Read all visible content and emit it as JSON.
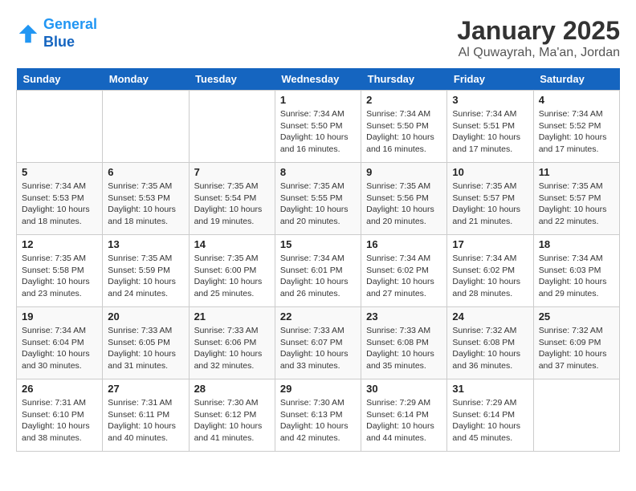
{
  "header": {
    "logo_line1": "General",
    "logo_line2": "Blue",
    "month": "January 2025",
    "location": "Al Quwayrah, Ma'an, Jordan"
  },
  "weekdays": [
    "Sunday",
    "Monday",
    "Tuesday",
    "Wednesday",
    "Thursday",
    "Friday",
    "Saturday"
  ],
  "weeks": [
    [
      {
        "day": "",
        "info": ""
      },
      {
        "day": "",
        "info": ""
      },
      {
        "day": "",
        "info": ""
      },
      {
        "day": "1",
        "info": "Sunrise: 7:34 AM\nSunset: 5:50 PM\nDaylight: 10 hours\nand 16 minutes."
      },
      {
        "day": "2",
        "info": "Sunrise: 7:34 AM\nSunset: 5:50 PM\nDaylight: 10 hours\nand 16 minutes."
      },
      {
        "day": "3",
        "info": "Sunrise: 7:34 AM\nSunset: 5:51 PM\nDaylight: 10 hours\nand 17 minutes."
      },
      {
        "day": "4",
        "info": "Sunrise: 7:34 AM\nSunset: 5:52 PM\nDaylight: 10 hours\nand 17 minutes."
      }
    ],
    [
      {
        "day": "5",
        "info": "Sunrise: 7:34 AM\nSunset: 5:53 PM\nDaylight: 10 hours\nand 18 minutes."
      },
      {
        "day": "6",
        "info": "Sunrise: 7:35 AM\nSunset: 5:53 PM\nDaylight: 10 hours\nand 18 minutes."
      },
      {
        "day": "7",
        "info": "Sunrise: 7:35 AM\nSunset: 5:54 PM\nDaylight: 10 hours\nand 19 minutes."
      },
      {
        "day": "8",
        "info": "Sunrise: 7:35 AM\nSunset: 5:55 PM\nDaylight: 10 hours\nand 20 minutes."
      },
      {
        "day": "9",
        "info": "Sunrise: 7:35 AM\nSunset: 5:56 PM\nDaylight: 10 hours\nand 20 minutes."
      },
      {
        "day": "10",
        "info": "Sunrise: 7:35 AM\nSunset: 5:57 PM\nDaylight: 10 hours\nand 21 minutes."
      },
      {
        "day": "11",
        "info": "Sunrise: 7:35 AM\nSunset: 5:57 PM\nDaylight: 10 hours\nand 22 minutes."
      }
    ],
    [
      {
        "day": "12",
        "info": "Sunrise: 7:35 AM\nSunset: 5:58 PM\nDaylight: 10 hours\nand 23 minutes."
      },
      {
        "day": "13",
        "info": "Sunrise: 7:35 AM\nSunset: 5:59 PM\nDaylight: 10 hours\nand 24 minutes."
      },
      {
        "day": "14",
        "info": "Sunrise: 7:35 AM\nSunset: 6:00 PM\nDaylight: 10 hours\nand 25 minutes."
      },
      {
        "day": "15",
        "info": "Sunrise: 7:34 AM\nSunset: 6:01 PM\nDaylight: 10 hours\nand 26 minutes."
      },
      {
        "day": "16",
        "info": "Sunrise: 7:34 AM\nSunset: 6:02 PM\nDaylight: 10 hours\nand 27 minutes."
      },
      {
        "day": "17",
        "info": "Sunrise: 7:34 AM\nSunset: 6:02 PM\nDaylight: 10 hours\nand 28 minutes."
      },
      {
        "day": "18",
        "info": "Sunrise: 7:34 AM\nSunset: 6:03 PM\nDaylight: 10 hours\nand 29 minutes."
      }
    ],
    [
      {
        "day": "19",
        "info": "Sunrise: 7:34 AM\nSunset: 6:04 PM\nDaylight: 10 hours\nand 30 minutes."
      },
      {
        "day": "20",
        "info": "Sunrise: 7:33 AM\nSunset: 6:05 PM\nDaylight: 10 hours\nand 31 minutes."
      },
      {
        "day": "21",
        "info": "Sunrise: 7:33 AM\nSunset: 6:06 PM\nDaylight: 10 hours\nand 32 minutes."
      },
      {
        "day": "22",
        "info": "Sunrise: 7:33 AM\nSunset: 6:07 PM\nDaylight: 10 hours\nand 33 minutes."
      },
      {
        "day": "23",
        "info": "Sunrise: 7:33 AM\nSunset: 6:08 PM\nDaylight: 10 hours\nand 35 minutes."
      },
      {
        "day": "24",
        "info": "Sunrise: 7:32 AM\nSunset: 6:08 PM\nDaylight: 10 hours\nand 36 minutes."
      },
      {
        "day": "25",
        "info": "Sunrise: 7:32 AM\nSunset: 6:09 PM\nDaylight: 10 hours\nand 37 minutes."
      }
    ],
    [
      {
        "day": "26",
        "info": "Sunrise: 7:31 AM\nSunset: 6:10 PM\nDaylight: 10 hours\nand 38 minutes."
      },
      {
        "day": "27",
        "info": "Sunrise: 7:31 AM\nSunset: 6:11 PM\nDaylight: 10 hours\nand 40 minutes."
      },
      {
        "day": "28",
        "info": "Sunrise: 7:30 AM\nSunset: 6:12 PM\nDaylight: 10 hours\nand 41 minutes."
      },
      {
        "day": "29",
        "info": "Sunrise: 7:30 AM\nSunset: 6:13 PM\nDaylight: 10 hours\nand 42 minutes."
      },
      {
        "day": "30",
        "info": "Sunrise: 7:29 AM\nSunset: 6:14 PM\nDaylight: 10 hours\nand 44 minutes."
      },
      {
        "day": "31",
        "info": "Sunrise: 7:29 AM\nSunset: 6:14 PM\nDaylight: 10 hours\nand 45 minutes."
      },
      {
        "day": "",
        "info": ""
      }
    ]
  ]
}
